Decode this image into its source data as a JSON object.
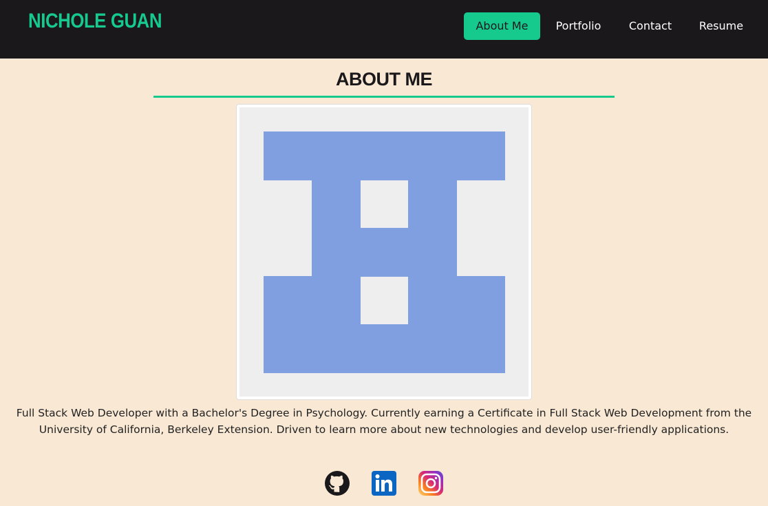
{
  "header": {
    "brand": "Nichole Guan",
    "nav": [
      {
        "label": "About Me",
        "active": true
      },
      {
        "label": "Portfolio",
        "active": false
      },
      {
        "label": "Contact",
        "active": false
      },
      {
        "label": "Resume",
        "active": false
      }
    ]
  },
  "main": {
    "title": "About Me",
    "avatar": {
      "icon": "identicon",
      "fg_color": "#7f9fe0",
      "bg_color": "#eeeeee"
    },
    "bio_line1": "Full Stack Web Developer with a Bachelor's Degree in Psychology. Currently earning a Certificate in Full Stack Web Development from the",
    "bio_line2": "University of California, Berkeley Extension. Driven to learn more about new technologies and develop user-friendly applications."
  },
  "socials": [
    {
      "icon": "github-icon"
    },
    {
      "icon": "linkedin-icon"
    },
    {
      "icon": "instagram-icon"
    }
  ],
  "colors": {
    "accent": "#16c98d",
    "nav_bg": "#1b181c",
    "page_bg": "#f8e8d4"
  }
}
